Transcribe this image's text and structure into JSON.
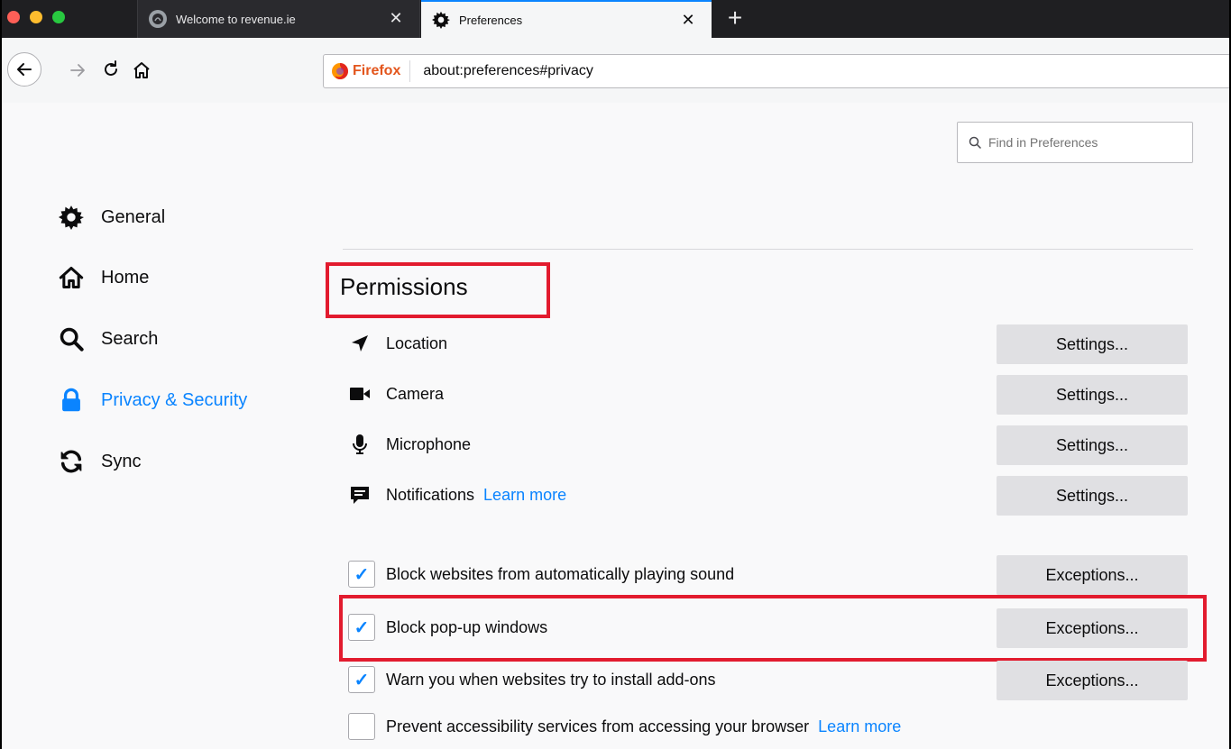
{
  "tabs": [
    {
      "title": "Welcome to revenue.ie",
      "close_glyph": "✕",
      "icon": "site-favicon"
    },
    {
      "title": "Preferences",
      "close_glyph": "✕",
      "icon": "gear-icon"
    }
  ],
  "new_tab_glyph": "+",
  "urlbar": {
    "identity_label": "Firefox",
    "url": "about:preferences#privacy"
  },
  "search": {
    "placeholder": "Find in Preferences"
  },
  "sidebar": {
    "items": [
      {
        "label": "General",
        "icon": "gear-icon"
      },
      {
        "label": "Home",
        "icon": "home-icon"
      },
      {
        "label": "Search",
        "icon": "search-icon"
      },
      {
        "label": "Privacy & Security",
        "icon": "lock-icon",
        "selected": true
      },
      {
        "label": "Sync",
        "icon": "sync-icon"
      }
    ]
  },
  "permissions": {
    "title": "Permissions",
    "rows": [
      {
        "label": "Location",
        "button": "Settings...",
        "icon": "location-arrow-icon"
      },
      {
        "label": "Camera",
        "button": "Settings...",
        "icon": "camera-icon"
      },
      {
        "label": "Microphone",
        "button": "Settings...",
        "icon": "microphone-icon"
      },
      {
        "label": "Notifications",
        "link": "Learn more",
        "button": "Settings...",
        "icon": "notification-icon"
      }
    ],
    "checkboxes": [
      {
        "label": "Block websites from automatically playing sound",
        "checked": true,
        "button": "Exceptions..."
      },
      {
        "label": "Block pop-up windows",
        "checked": true,
        "button": "Exceptions..."
      },
      {
        "label": "Warn you when websites try to install add-ons",
        "checked": true,
        "button": "Exceptions..."
      },
      {
        "label": "Prevent accessibility services from accessing your browser",
        "checked": false,
        "link": "Learn more"
      }
    ],
    "check_glyph": "✓"
  },
  "colors": {
    "accent": "#0a84ff",
    "highlight": "#e21b2e",
    "firefox_brand": "#e3561d"
  }
}
